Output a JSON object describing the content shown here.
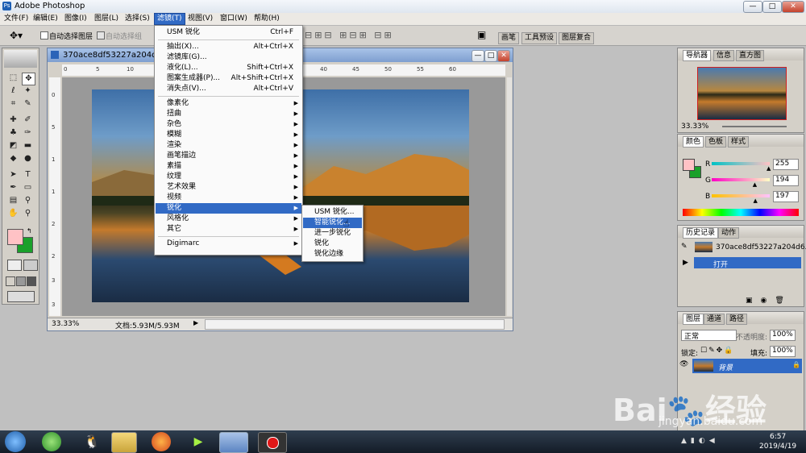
{
  "window": {
    "title": "Adobe Photoshop",
    "minimize": "—",
    "maximize": "□",
    "close": "✕"
  },
  "menubar": [
    "文件(F)",
    "编辑(E)",
    "图像(I)",
    "图层(L)",
    "选择(S)",
    "滤镜(T)",
    "视图(V)",
    "窗口(W)",
    "帮助(H)"
  ],
  "options": {
    "auto_select_layer": "自动选择图层",
    "auto_select_group": "自动选择组",
    "tabs": [
      "画笔",
      "工具预设",
      "图层复合"
    ]
  },
  "document": {
    "title": "370ace8df53227a204d64c",
    "zoom": "33.33%",
    "doc_size": "文档:5.93M/5.93M",
    "ruler_top": [
      "0",
      "5",
      "10",
      "15",
      "20",
      "25",
      "30",
      "35",
      "40",
      "45",
      "50",
      "55",
      "60"
    ],
    "ruler_left": [
      "0",
      "5",
      "1",
      "1",
      "2",
      "2",
      "3",
      "3"
    ]
  },
  "filter_menu": [
    {
      "label": "USM 锐化",
      "shortcut": "Ctrl+F",
      "submenu": false
    },
    {
      "sep": true
    },
    {
      "label": "抽出(X)...",
      "shortcut": "Alt+Ctrl+X",
      "submenu": false
    },
    {
      "label": "滤镜库(G)...",
      "shortcut": "",
      "submenu": false
    },
    {
      "label": "液化(L)...",
      "shortcut": "Shift+Ctrl+X",
      "submenu": false
    },
    {
      "label": "图案生成器(P)...",
      "shortcut": "Alt+Shift+Ctrl+X",
      "submenu": false
    },
    {
      "label": "消失点(V)...",
      "shortcut": "Alt+Ctrl+V",
      "submenu": false
    },
    {
      "sep": true
    },
    {
      "label": "像素化",
      "shortcut": "",
      "submenu": true
    },
    {
      "label": "扭曲",
      "shortcut": "",
      "submenu": true
    },
    {
      "label": "杂色",
      "shortcut": "",
      "submenu": true
    },
    {
      "label": "模糊",
      "shortcut": "",
      "submenu": true
    },
    {
      "label": "渲染",
      "shortcut": "",
      "submenu": true
    },
    {
      "label": "画笔描边",
      "shortcut": "",
      "submenu": true
    },
    {
      "label": "素描",
      "shortcut": "",
      "submenu": true
    },
    {
      "label": "纹理",
      "shortcut": "",
      "submenu": true
    },
    {
      "label": "艺术效果",
      "shortcut": "",
      "submenu": true
    },
    {
      "label": "视频",
      "shortcut": "",
      "submenu": true
    },
    {
      "label": "锐化",
      "shortcut": "",
      "submenu": true,
      "highlight": true
    },
    {
      "label": "风格化",
      "shortcut": "",
      "submenu": true
    },
    {
      "label": "其它",
      "shortcut": "",
      "submenu": true
    },
    {
      "sep": true
    },
    {
      "label": "Digimarc",
      "shortcut": "",
      "submenu": true
    }
  ],
  "sharpen_submenu": [
    {
      "label": "USM 锐化..."
    },
    {
      "label": "智能锐化...",
      "highlight": true
    },
    {
      "label": "进一步锐化"
    },
    {
      "label": "锐化"
    },
    {
      "label": "锐化边缘"
    }
  ],
  "navigator": {
    "tabs": [
      "导航器",
      "信息",
      "直方图"
    ],
    "zoom": "33.33%"
  },
  "color": {
    "tabs": [
      "颜色",
      "色板",
      "样式"
    ],
    "r_label": "R",
    "g_label": "G",
    "b_label": "B",
    "r": "255",
    "g": "194",
    "b": "197",
    "r_frac": 1.0,
    "g_frac": 0.76,
    "b_frac": 0.77
  },
  "history": {
    "tabs": [
      "历史记录",
      "动作"
    ],
    "snapshot": "370ace8df53227a204d6...",
    "step": "打开"
  },
  "layers": {
    "tabs": [
      "图层",
      "通道",
      "路径"
    ],
    "blend": "正常",
    "opacity_label": "不透明度:",
    "opacity": "100%",
    "lock_label": "锁定:",
    "fill_label": "填充:",
    "fill": "100%",
    "layer_name": "背景"
  },
  "taskbar": {
    "time": "6:57",
    "date": "2019/4/19"
  },
  "watermark": {
    "brand": "Bai",
    "brand2": "经验",
    "url": "jingyan.baidu.com"
  },
  "colors": {
    "highlight": "#316ac5",
    "fg_swatch": "#ffc2c5",
    "bg_swatch": "#1aa02a"
  }
}
